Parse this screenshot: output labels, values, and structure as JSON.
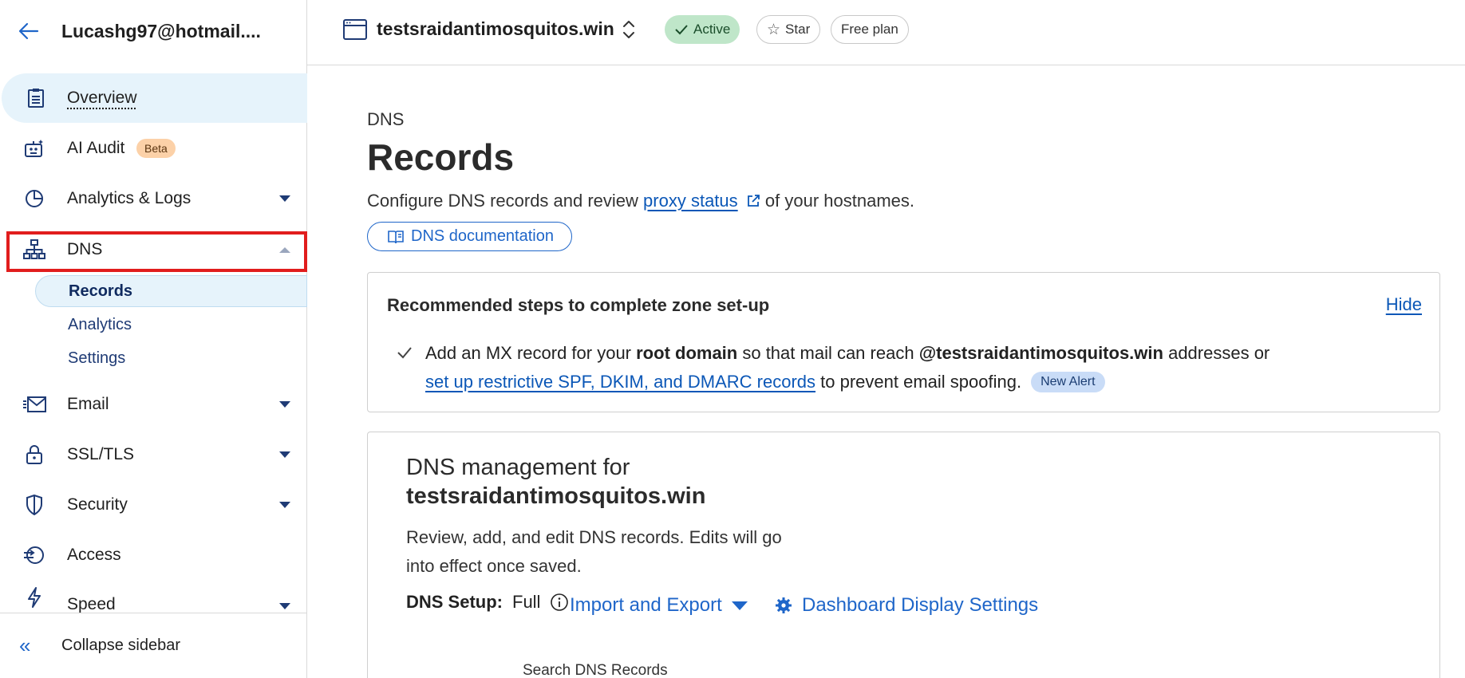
{
  "sidebar": {
    "account": "Lucashg97@hotmail....",
    "items": [
      {
        "label": "Overview",
        "icon": "clipboard-icon"
      },
      {
        "label": "AI Audit",
        "badge": "Beta",
        "icon": "robot-icon"
      },
      {
        "label": "Analytics & Logs",
        "icon": "pie-chart-icon"
      },
      {
        "label": "DNS",
        "icon": "sitemap-icon"
      },
      {
        "label": "Email",
        "icon": "envelope-icon"
      },
      {
        "label": "SSL/TLS",
        "icon": "lock-icon"
      },
      {
        "label": "Security",
        "icon": "shield-icon"
      },
      {
        "label": "Access",
        "icon": "access-icon"
      },
      {
        "label": "Speed",
        "icon": "bolt-icon"
      }
    ],
    "dns_sub": [
      "Records",
      "Analytics",
      "Settings"
    ],
    "collapse": "Collapse sidebar"
  },
  "topbar": {
    "zone": "testsraidantimosquitos.win",
    "status": "Active",
    "star": "Star",
    "plan": "Free plan"
  },
  "main": {
    "breadcrumb": "DNS",
    "title": "Records",
    "desc_pre": "Configure DNS records and review ",
    "desc_link": "proxy status",
    "desc_post": " of your hostnames.",
    "doc_button": "DNS documentation",
    "steps": {
      "title": "Recommended steps to complete zone set-up",
      "hide": "Hide",
      "line1_a": "Add an MX record for your ",
      "line1_b": "root domain",
      "line1_c": " so that mail can reach ",
      "line1_d": "@testsraidantimosquitos.win",
      "line1_e": " addresses or",
      "line2_link": "set up restrictive SPF, DKIM, and DMARC records",
      "line2_post": " to prevent email spoofing.",
      "badge": "New Alert"
    },
    "mgmt": {
      "heading": "DNS management for",
      "zone": "testsraidantimosquitos.win",
      "desc": "Review, add, and edit DNS records. Edits will go into effect once saved.",
      "setup_label": "DNS Setup:",
      "setup_value": "Full",
      "import_export": "Import and Export",
      "dashboard_settings": "Dashboard Display Settings",
      "search_label": "Search DNS Records"
    }
  },
  "colors": {
    "accent": "#1f66c9",
    "highlight": "#e11d1d",
    "active_pill": "#bfe6c9"
  }
}
